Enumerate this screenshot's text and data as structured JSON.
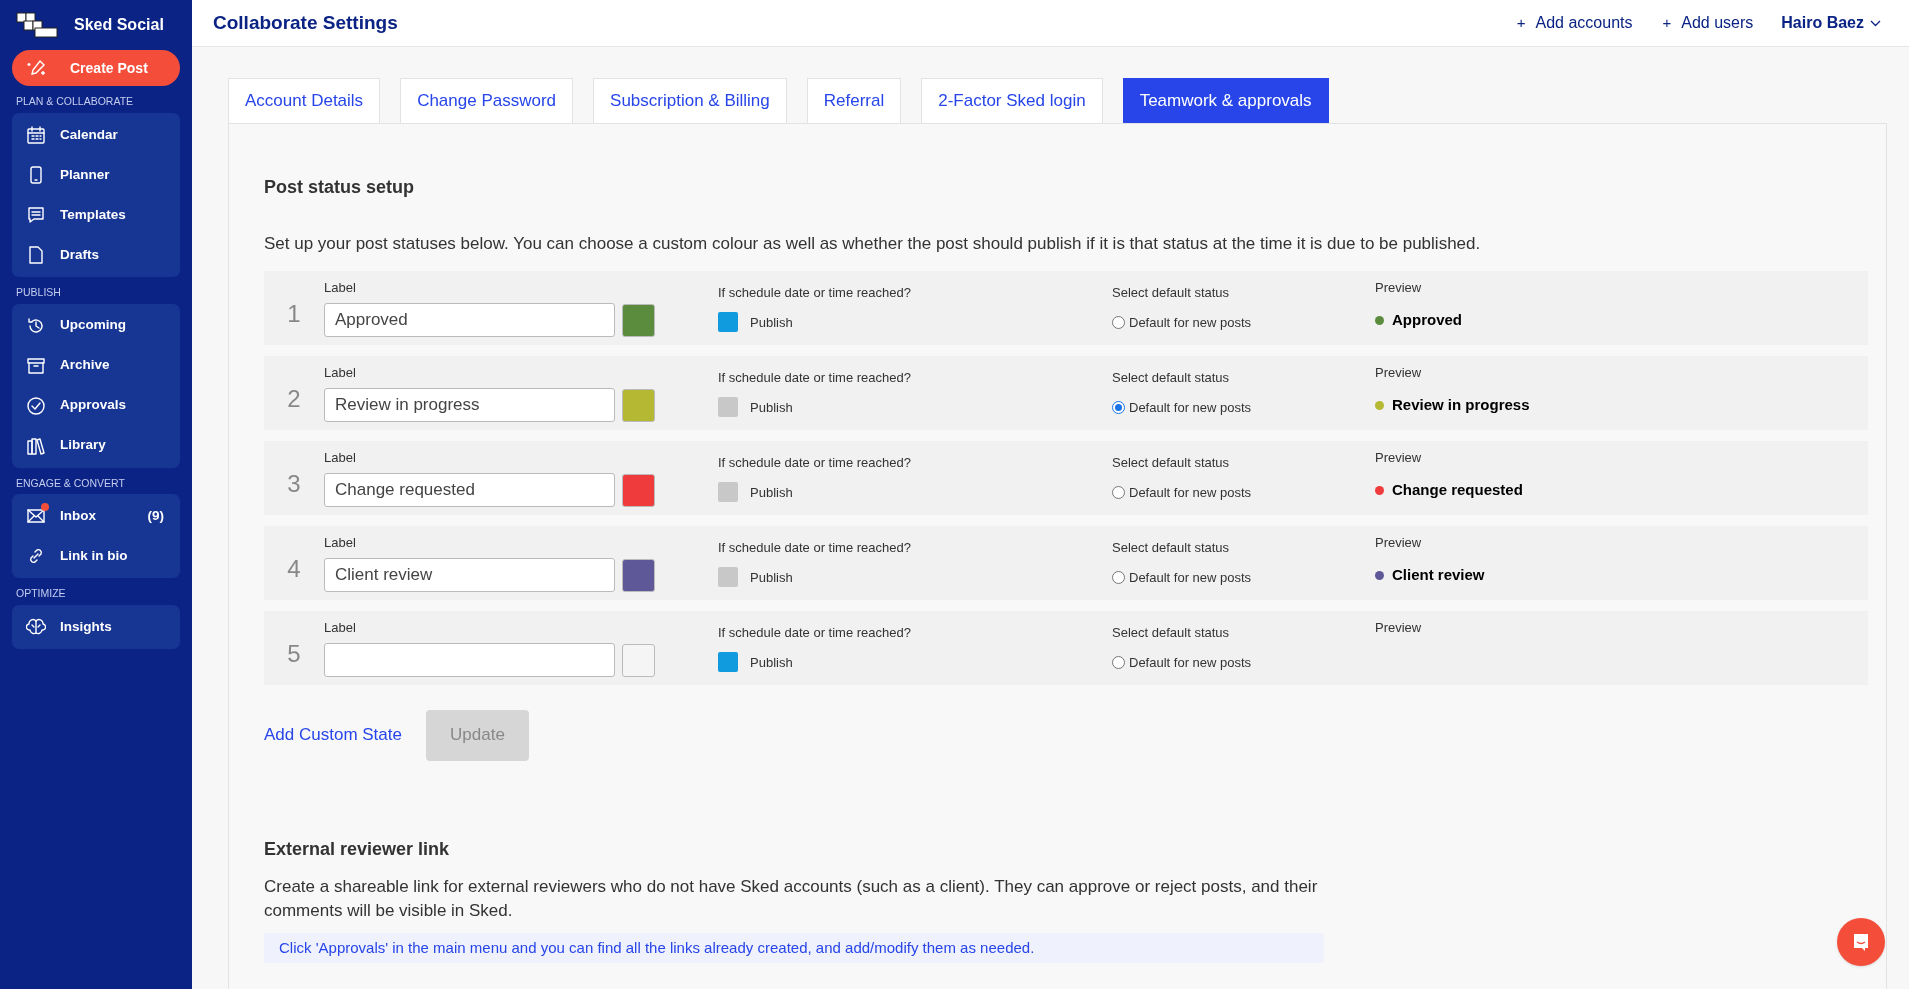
{
  "sidebar": {
    "brand": "Sked Social",
    "create_post": "Create Post",
    "sections": [
      {
        "heading": "PLAN & COLLABORATE",
        "items": [
          {
            "label": "Calendar",
            "unread": false
          },
          {
            "label": "Planner",
            "unread": false
          },
          {
            "label": "Templates",
            "unread": false
          },
          {
            "label": "Drafts",
            "unread": false
          }
        ]
      },
      {
        "heading": "PUBLISH",
        "items": [
          {
            "label": "Upcoming",
            "unread": false
          },
          {
            "label": "Archive",
            "unread": false
          },
          {
            "label": "Approvals",
            "unread": false
          },
          {
            "label": "Library",
            "unread": false
          }
        ]
      },
      {
        "heading": "ENGAGE & CONVERT",
        "items": [
          {
            "label": "Inbox",
            "count": "(9)",
            "unread": true
          },
          {
            "label": "Link in bio",
            "unread": false
          }
        ]
      },
      {
        "heading": "OPTIMIZE",
        "items": [
          {
            "label": "Insights",
            "unread": false
          }
        ]
      }
    ]
  },
  "header": {
    "title": "Collaborate Settings",
    "links": [
      {
        "icon": "+",
        "label": "Add accounts"
      },
      {
        "icon": "+",
        "label": "Add users"
      }
    ],
    "user": "Hairo Baez"
  },
  "tabs": [
    {
      "label": "Account Details",
      "selected": false
    },
    {
      "label": "Change Password",
      "selected": false
    },
    {
      "label": "Subscription & Billing",
      "selected": false
    },
    {
      "label": "Referral",
      "selected": false
    },
    {
      "label": "2-Factor Sked login",
      "selected": false
    },
    {
      "label": "Teamwork & approvals",
      "selected": true
    }
  ],
  "post_status": {
    "title": "Post status setup",
    "description": "Set up your post statuses below. You can choose a custom colour as well as whether the post should publish if it is that status at the time it is due to be published.",
    "rows": [
      {
        "number": "1",
        "label_heading": "Label",
        "value": "Approved",
        "color": "#5b8c3e",
        "publish_heading": "If schedule date or time reached?",
        "publish_label": "Publish",
        "publish": true,
        "default_heading": "Select default status",
        "default_label": "Default for new posts",
        "selected": false,
        "preview_heading": "Preview",
        "preview": "Approved"
      },
      {
        "number": "2",
        "label_heading": "Label",
        "value": "Review in progress",
        "color": "#b4b832",
        "publish_heading": "If schedule date or time reached?",
        "publish_label": "Publish",
        "publish": false,
        "default_heading": "Select default status",
        "default_label": "Default for new posts",
        "selected": true,
        "preview_heading": "Preview",
        "preview": "Review in progress"
      },
      {
        "number": "3",
        "label_heading": "Label",
        "value": "Change requested",
        "color": "#ef3b3b",
        "publish_heading": "If schedule date or time reached?",
        "publish_label": "Publish",
        "publish": false,
        "default_heading": "Select default status",
        "default_label": "Default for new posts",
        "selected": false,
        "preview_heading": "Preview",
        "preview": "Change requested"
      },
      {
        "number": "4",
        "label_heading": "Label",
        "value": "Client review",
        "color": "#5e5898",
        "publish_heading": "If schedule date or time reached?",
        "publish_label": "Publish",
        "publish": false,
        "default_heading": "Select default status",
        "default_label": "Default for new posts",
        "selected": false,
        "preview_heading": "Preview",
        "preview": "Client review"
      },
      {
        "number": "5",
        "label_heading": "Label",
        "publish_heading": "If schedule date or time reached?",
        "publish_label": "Publish",
        "publish": true,
        "default_heading": "Select default status",
        "default_label": "Default for new posts",
        "selected": false,
        "preview_heading": "Preview"
      }
    ],
    "add_link": "Add Custom State",
    "update_button": {
      "label": "Update",
      "disabled": true
    }
  },
  "external": {
    "title": "External reviewer link",
    "description": "Create a shareable link for external reviewers who do not have Sked accounts (such as a client). They can approve or reject posts, and their comments will be visible in Sked.",
    "note": "Click 'Approvals' in the main menu and you can find all the links already created, and add/modify them as needed."
  }
}
